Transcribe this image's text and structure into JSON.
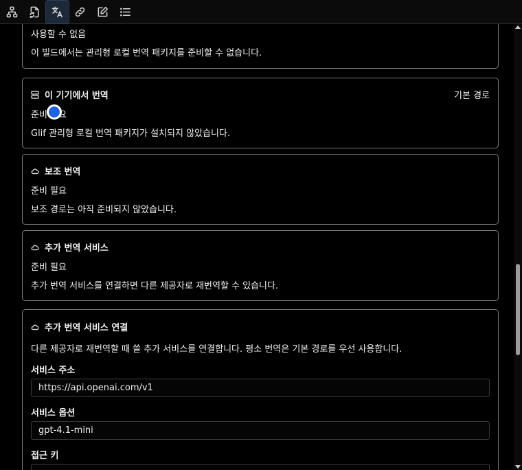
{
  "toolbar": {
    "items": [
      {
        "icon": "sitemap-icon"
      },
      {
        "icon": "file-sync-icon"
      },
      {
        "icon": "translate-icon",
        "active": true
      },
      {
        "icon": "link-icon"
      },
      {
        "icon": "edit-icon"
      },
      {
        "icon": "list-icon"
      }
    ]
  },
  "cards": {
    "unavailable": {
      "status": "사용할 수 없음",
      "desc": "이 빌드에서는 관리형 로컬 번역 패키지를 준비할 수 없습니다."
    },
    "on_device": {
      "title": "이 기기에서 번역",
      "route": "기본 경로",
      "status": "준비 필요",
      "desc": "Glif 관리형 로컬 번역 패키지가 설치되지 않았습니다."
    },
    "secondary": {
      "title": "보조 번역",
      "status": "준비 필요",
      "desc": "보조 경로는 아직 준비되지 않았습니다."
    },
    "extra_service": {
      "title": "추가 번역 서비스",
      "status": "준비 필요",
      "desc": "추가 번역 서비스를 연결하면 다른 제공자로 재번역할 수 있습니다."
    },
    "connect": {
      "title": "추가 번역 서비스 연결",
      "desc": "다른 제공자로 재번역할 때 쓸 추가 서비스를 연결합니다. 평소 번역은 기본 경로를 우선 사용합니다.",
      "service_url_label": "서비스 주소",
      "service_url_value": "https://api.openai.com/v1",
      "service_option_label": "서비스 옵션",
      "service_option_value": "gpt-4.1-mini",
      "access_key_label": "접근 키"
    }
  }
}
